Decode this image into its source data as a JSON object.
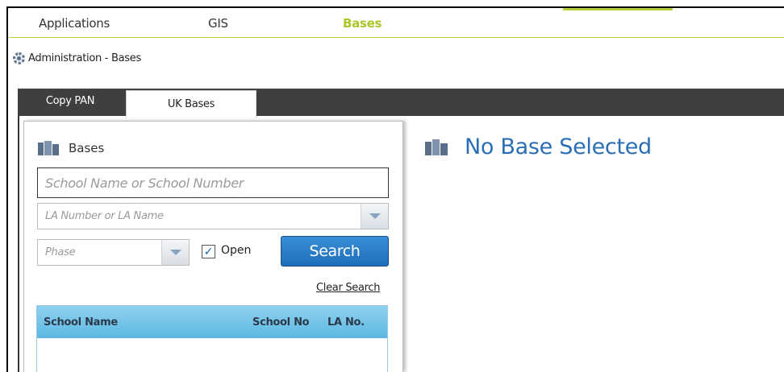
{
  "topnav": {
    "items": [
      {
        "label": "Applications",
        "active": false
      },
      {
        "label": "GIS",
        "active": false
      },
      {
        "label": "Bases",
        "active": true
      }
    ]
  },
  "breadcrumb": {
    "text": "Administration - Bases",
    "icon": "gear-icon"
  },
  "tabs": [
    {
      "label": "Copy PAN",
      "active": false
    },
    {
      "label": "UK Bases",
      "active": true
    }
  ],
  "panel": {
    "title": "Bases",
    "school_search": {
      "placeholder": "School Name or School Number",
      "value": ""
    },
    "la_select": {
      "placeholder": "LA Number or LA Name",
      "value": ""
    },
    "phase_select": {
      "placeholder": "Phase",
      "value": ""
    },
    "open_checkbox": {
      "label": "Open",
      "checked": true,
      "checkmark": "✓"
    },
    "search_button": "Search",
    "clear_search": "Clear Search",
    "grid": {
      "columns": [
        "School Name",
        "School No",
        "LA No."
      ],
      "rows": []
    }
  },
  "detail": {
    "title": "No Base Selected"
  },
  "colors": {
    "accent_green": "#a8c62a",
    "tab_bar": "#3f3f3f",
    "search_button": "#1f6db8",
    "grid_header": "#5cb8e2",
    "title_blue": "#2a6fb5"
  }
}
